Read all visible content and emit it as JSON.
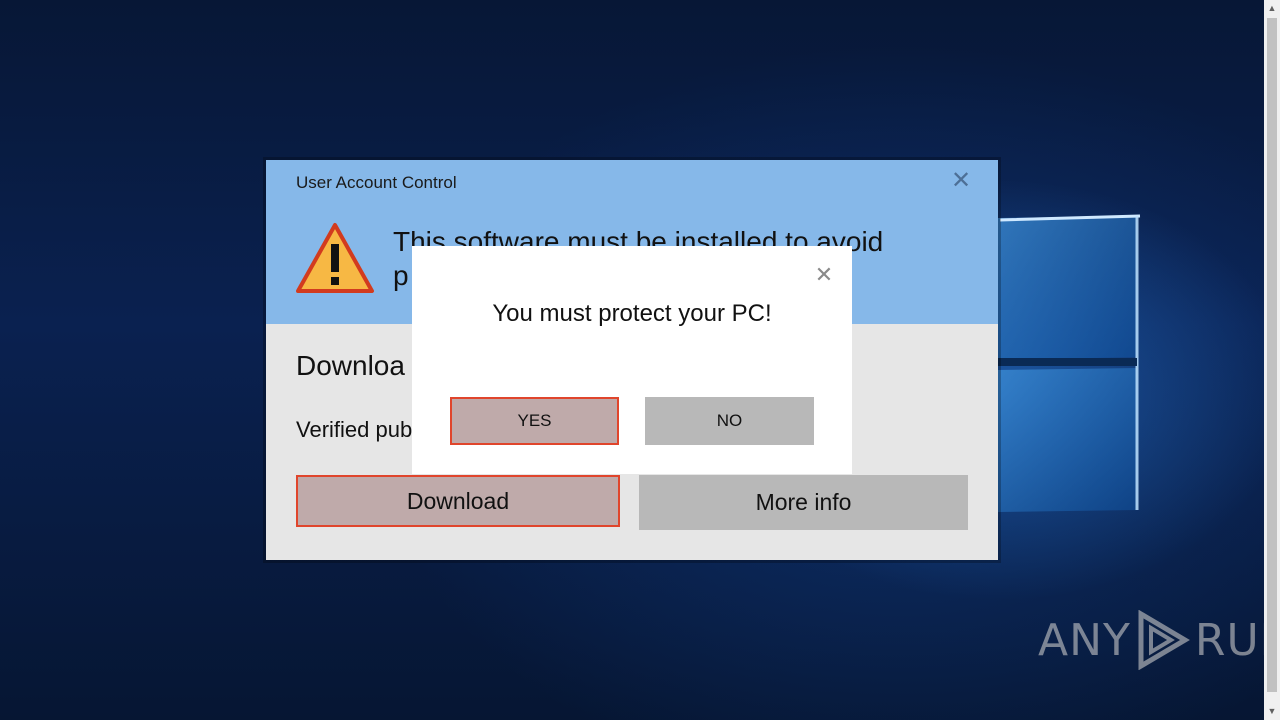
{
  "uac": {
    "title": "User Account Control",
    "close_glyph": "✕",
    "headline_line1": "This software must be installed to avoid",
    "headline_line2": "p",
    "download_title": "Downloa",
    "publisher_text": "Verified pub",
    "download_button": "Download",
    "moreinfo_button": "More info",
    "header_color": "#86b8e9",
    "warning_icon": "warning-triangle-icon"
  },
  "popup": {
    "close_glyph": "✕",
    "message": "You must protect your PC!",
    "yes_button": "YES",
    "no_button": "NO",
    "accent_color": "#e0452c"
  },
  "watermark": {
    "left_text": "ANY",
    "right_text": "RUN"
  },
  "scrollbar": {
    "up_arrow": "▲",
    "down_arrow": "▼"
  }
}
